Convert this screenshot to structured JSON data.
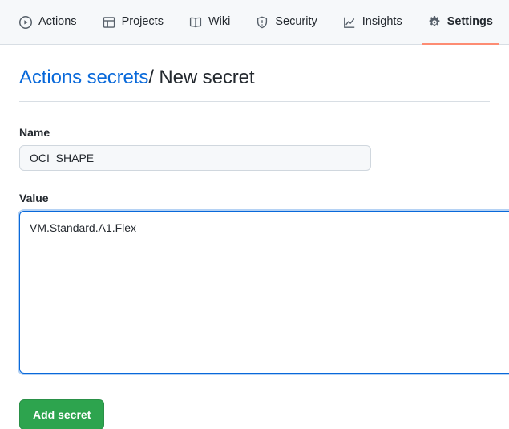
{
  "nav": {
    "tabs": [
      {
        "label": "Actions",
        "icon": "play-circle-icon",
        "active": false
      },
      {
        "label": "Projects",
        "icon": "table-icon",
        "active": false
      },
      {
        "label": "Wiki",
        "icon": "book-icon",
        "active": false
      },
      {
        "label": "Security",
        "icon": "shield-icon",
        "active": false
      },
      {
        "label": "Insights",
        "icon": "graph-icon",
        "active": false
      },
      {
        "label": "Settings",
        "icon": "gear-icon",
        "active": true
      }
    ],
    "active_indicator_color": "#fd8c73",
    "background_color": "#f6f8fa"
  },
  "breadcrumb": {
    "link_text": "Actions secrets",
    "separator": "/",
    "current": "New secret",
    "link_color": "#0969da"
  },
  "form": {
    "name": {
      "label": "Name",
      "value": "OCI_SHAPE",
      "placeholder": "",
      "background_color": "#f6f8fa"
    },
    "value": {
      "label": "Value",
      "value": "VM.Standard.A1.Flex",
      "placeholder": "",
      "focused": true,
      "focus_color": "#0969da"
    },
    "submit": {
      "label": "Add secret",
      "background_color": "#2da44e"
    }
  }
}
